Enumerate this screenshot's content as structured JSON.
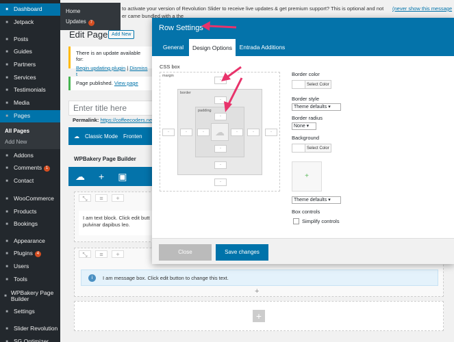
{
  "sidebar": {
    "items": [
      {
        "label": "Dashboard",
        "icon": "dashboard-icon"
      },
      {
        "label": "Jetpack",
        "icon": "jetpack-icon"
      },
      {
        "label": "Posts",
        "icon": "pin-icon"
      },
      {
        "label": "Guides",
        "icon": "guides-icon"
      },
      {
        "label": "Partners",
        "icon": "partners-icon"
      },
      {
        "label": "Services",
        "icon": "services-icon"
      },
      {
        "label": "Testimonials",
        "icon": "testimonials-icon"
      },
      {
        "label": "Media",
        "icon": "media-icon"
      },
      {
        "label": "Pages",
        "icon": "pages-icon"
      },
      {
        "label": "Addons",
        "icon": "addons-icon"
      },
      {
        "label": "Comments",
        "icon": "comment-icon",
        "badge": "1"
      },
      {
        "label": "Contact",
        "icon": "mail-icon"
      },
      {
        "label": "WooCommerce",
        "icon": "woocommerce-icon"
      },
      {
        "label": "Products",
        "icon": "products-icon"
      },
      {
        "label": "Bookings",
        "icon": "calendar-icon"
      },
      {
        "label": "Appearance",
        "icon": "brush-icon"
      },
      {
        "label": "Plugins",
        "icon": "plugin-icon",
        "badge": "4"
      },
      {
        "label": "Users",
        "icon": "users-icon"
      },
      {
        "label": "Tools",
        "icon": "wrench-icon"
      },
      {
        "label": "WPBakery Page Builder",
        "icon": "wpbakery-icon"
      },
      {
        "label": "Settings",
        "icon": "settings-icon"
      },
      {
        "label": "Slider Revolution",
        "icon": "slider-icon"
      },
      {
        "label": "SG Optimizer",
        "icon": "optimizer-icon"
      }
    ],
    "pages_sub": {
      "all": "All Pages",
      "add": "Add New"
    },
    "dashboard_flyout": {
      "home": "Home",
      "updates": "Updates",
      "updates_badge": "7"
    }
  },
  "top_notice": {
    "line1": "to activate your version of Revolution Slider to receive live updates & get premium support? This is optional and not",
    "line2": "er came bundled with a the",
    "dismiss": "(never show this message"
  },
  "page": {
    "title": "Edit Page",
    "add_new": "Add New",
    "update_notice": "There is an update available for:",
    "update_link": "Begin updating plugin",
    "dismiss_link": "Dismiss t",
    "published": "Page published.",
    "view_page": "View page",
    "title_placeholder": "Enter title here",
    "permalink_label": "Permalink:",
    "permalink_url": "https://coffeecoders.net",
    "classic_mode": "Classic Mode",
    "frontend": "Fronten"
  },
  "wpbakery": {
    "title": "WPBakery Page Builder",
    "text_block": "I am text block. Click edit butt pulvinar dapibus leo.",
    "message_box": "I am message box. Click edit button to change this text."
  },
  "modal": {
    "title": "Row Settings",
    "tabs": [
      "General",
      "Design Options",
      "Entrada Additions"
    ],
    "css_box": "CSS box",
    "margin": "margin",
    "border": "border",
    "padding": "padding",
    "border_color": "Border color",
    "select_color": "Select Color",
    "border_style": "Border style",
    "border_style_value": "Theme defaults",
    "border_radius": "Border radius",
    "border_radius_value": "None",
    "background": "Background",
    "bg_select_color": "Select Color",
    "bg_style_value": "Theme defaults",
    "box_controls": "Box controls",
    "simplify": "Simplify controls",
    "close": "Close",
    "save": "Save changes"
  },
  "colors": {
    "accent": "#0073aa",
    "sidebar": "#23282d",
    "arrow": "#e8336b",
    "badge": "#d54e21"
  }
}
